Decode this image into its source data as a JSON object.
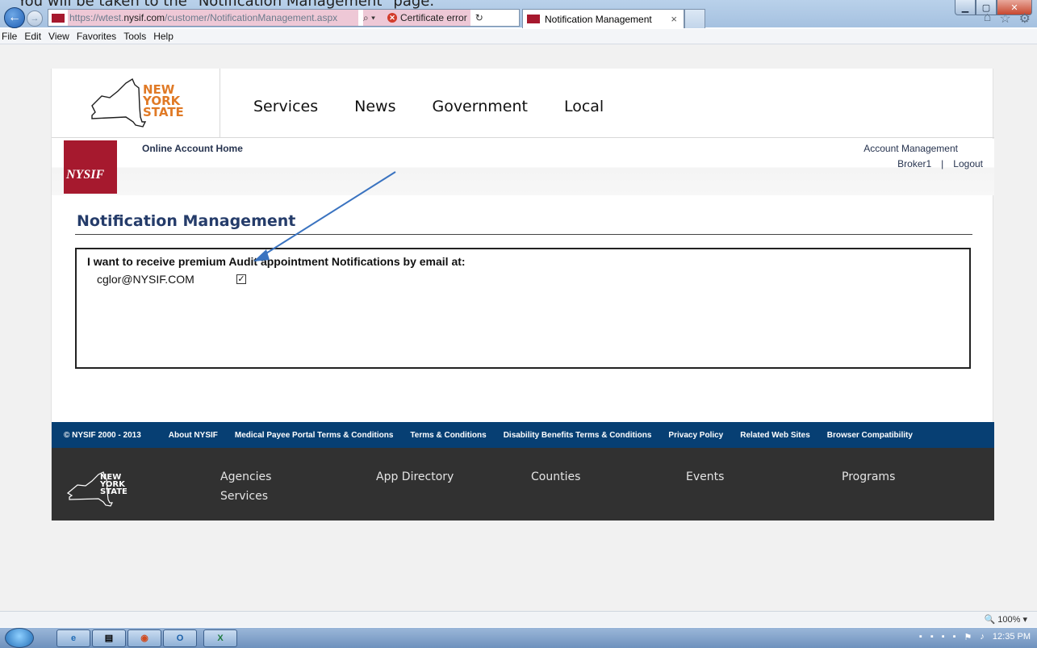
{
  "caption": "You will be taken to the \"Notification Management\" page.",
  "browser": {
    "url_prefix": "https://wtest.",
    "url_domain": "nysif.com",
    "url_path": "/customer/NotificationManagement.aspx",
    "search_icon": "⌕ ▾",
    "cert_error": "Certificate error",
    "tab_title": "Notification Management",
    "tab_close": "×",
    "menu": [
      "File",
      "Edit",
      "View",
      "Favorites",
      "Tools",
      "Help"
    ],
    "zoom": "100%"
  },
  "nys_header": {
    "logo_lines": [
      "NEW",
      "YORK",
      "STATE"
    ],
    "nav": [
      "Services",
      "News",
      "Government",
      "Local"
    ]
  },
  "account_bar": {
    "logo": "NYSIF",
    "online_home": "Online Account Home",
    "account_management": "Account Management",
    "user": "Broker1",
    "separator": "|",
    "logout": "Logout"
  },
  "notification": {
    "title": "Notification Management",
    "label": "I want to receive premium Audit appointment Notifications by email at:",
    "email": "cglor@NYSIF.COM",
    "checked": true
  },
  "footer_links": {
    "copyright": "© NYSIF 2000 - 2013",
    "items": [
      "About NYSIF",
      "Medical Payee Portal Terms & Conditions",
      "Terms & Conditions",
      "Disability Benefits Terms & Conditions",
      "Privacy Policy",
      "Related Web Sites",
      "Browser Compatibility"
    ]
  },
  "nys_footer": {
    "logo_lines": [
      "NEW",
      "YORK",
      "STATE"
    ],
    "links": [
      "Agencies",
      "Services",
      "App Directory",
      "Counties",
      "Events",
      "Programs"
    ]
  },
  "taskbar": {
    "outlook_label": "O",
    "excel_label": "X",
    "time": "12:35 PM"
  },
  "colors": {
    "nysif_red": "#a6192e",
    "footer_blue": "#073f73",
    "footer_dark": "#313131",
    "title_blue": "#253c6a",
    "arrow_blue": "#3a73c0"
  }
}
